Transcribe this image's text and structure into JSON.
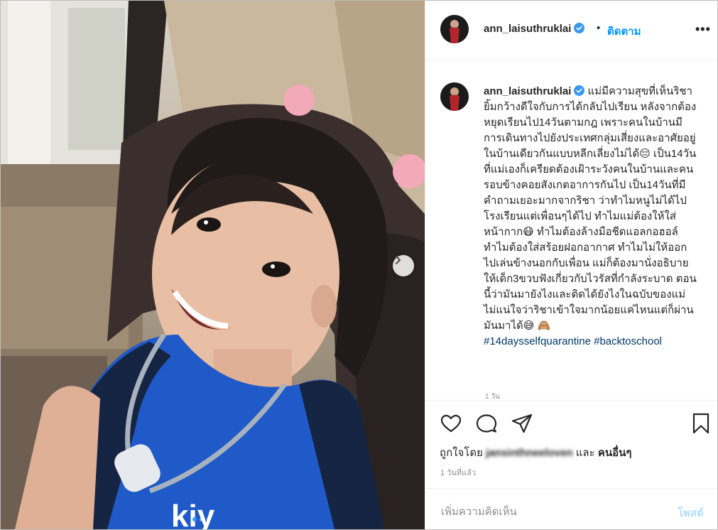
{
  "post": {
    "username": "ann_laisuthruklai",
    "separator": "•",
    "follow_label": "ติดตาม",
    "more_label": "•••",
    "caption": "แม่มีความสุขที่เห็นริชายิ้มกว้างดีใจกับการได้กลับไปเรียน หลังจากต้องหยุดเรียนไป14วันตามกฎ เพราะคนในบ้านมีการเดินทางไปยังประเทศกลุ่มเสี่ยงและอาศัยอยู่ในบ้านเดียวกันแบบหลีกเลี่ยงไม่ได้😔 เป็น14วันที่แม่เองก็เครียดต้องเฝ้าระวังคนในบ้านและคนรอบข้างคอยสังเกตอาการกันไป เป็น14วันที่มีคำถามเยอะมากจากริชา ว่าทำไมหนูไม่ได้ไปโรงเรียนแต่เพื่อนๆได้ไป ทำไมแม่ต้องให้ใส่หน้ากาก😷 ทำไมต้องล้างมือชีดแอลกอฮอล์ ทำไมต้องใส่สร้อยฝอกอากาศ ทำไมไม่ให้ออกไปเล่นข้างนอกกับเพื่อน แม่ก็ต้องมานั่งอธิบายให้เด็ก3ขวบฟังเกี่ยวกับไวรัสที่กำลังระบาด ตอนนี้ว่ามันมายังไงและติดได้ยังไงในฉบับของแม่ ไม่แน่ใจว่าริชาเข้าใจมากน้อยแค่ไหนแต่ก็ผ่านมันมาได้😅 🙈",
    "hashtags": "#14daysselfquarantine #backtoschool",
    "caption_time": "1 วัน",
    "liked_prefix": "ถูกใจโดย",
    "liked_user": "jansinthneeloven",
    "liked_and": "และ",
    "liked_others": "คนอื่นๆ",
    "time_ago": "1 วันที่แล้ว",
    "comment_placeholder": "เพิ่มความคิดเห็น",
    "post_button": "โพสต์"
  },
  "icons": {
    "header_avatar": "avatar",
    "verified": "verified-badge-icon",
    "like": "heart-icon",
    "comment": "comment-bubble-icon",
    "share": "paper-plane-icon",
    "save": "bookmark-icon",
    "next": "chevron-right-icon"
  },
  "carousel": {
    "slides": 3,
    "active_index": 0
  },
  "colors": {
    "link": "#0095f6",
    "hashtag": "#00376b",
    "muted": "#8e8e8e",
    "post_disabled": "#b2dffc"
  }
}
